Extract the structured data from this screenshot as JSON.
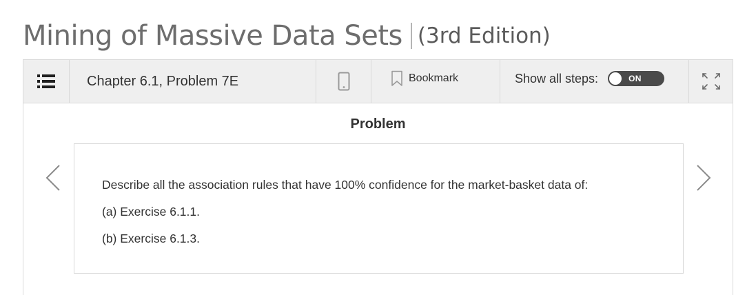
{
  "book": {
    "title": "Mining of Massive Data Sets",
    "edition": "(3rd Edition)"
  },
  "toolbar": {
    "list_icon": "list-icon",
    "chapter_label": "Chapter 6.1, Problem 7E",
    "device_icon": "mobile-phone-icon",
    "bookmark_icon": "bookmark-icon",
    "bookmark_label": "Bookmark",
    "show_steps_label": "Show all steps:",
    "toggle_label": "ON",
    "toggle_on": true,
    "expand_icon": "expand-icon"
  },
  "content": {
    "heading": "Problem",
    "problem_lines": [
      "Describe all the association rules that have 100% confidence for the market-basket data of:",
      "(a) Exercise 6.1.1.",
      "(b) Exercise 6.1.3."
    ],
    "prev_icon": "chevron-left-icon",
    "next_icon": "chevron-right-icon"
  },
  "colors": {
    "title_gray": "#6d6d6d",
    "toolbar_bg": "#efefef",
    "border": "#d9d9d9",
    "toggle_bg": "#4a4a4a",
    "text": "#333333"
  }
}
